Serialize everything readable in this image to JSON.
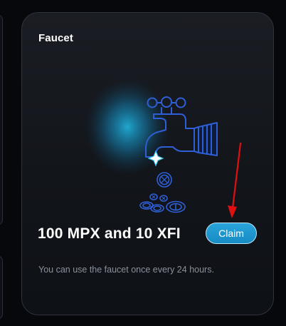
{
  "faucet": {
    "title": "Faucet",
    "amount_text": "100 MPX and 10 XFI",
    "claim_label": "Claim",
    "hint": "You can use the faucet once every 24 hours."
  },
  "colors": {
    "accent": "#1a93cc",
    "illustration_line": "#2f5fd6",
    "glow": "#1fb6e6",
    "annotation_arrow": "#e01010"
  },
  "icons": {
    "illustration": "faucet-dripping-coins",
    "annotation": "red-arrow-down"
  }
}
